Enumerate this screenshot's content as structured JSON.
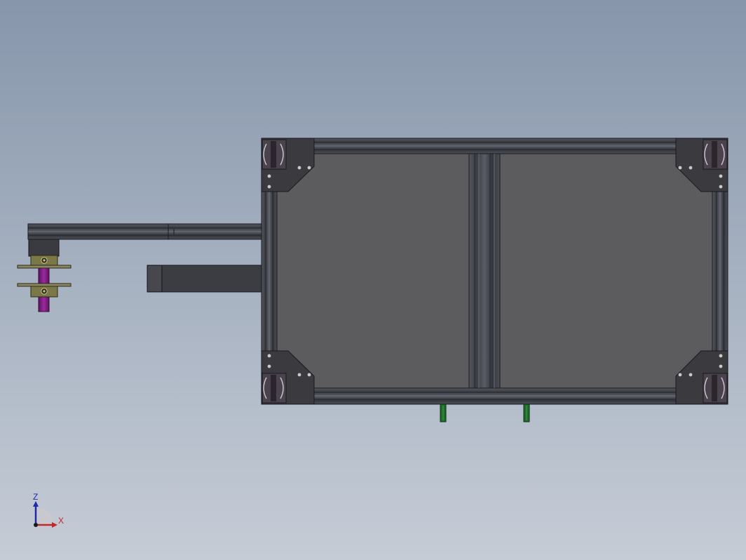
{
  "view": {
    "background_top": "#8796ab",
    "background_bottom": "#c6ccd6"
  },
  "model": {
    "frame_color": "#3c3e46",
    "panel_color": "#5c5c5f",
    "bracket_color": "#3a3a3f",
    "leg_color": "#1f6b2a",
    "clamp_color": "#7b7848",
    "shaft_color": "#7a1a7e"
  },
  "triad": {
    "z_label": "Z",
    "x_label": "X",
    "z_color": "#1d2aa8",
    "x_color": "#c0282b"
  }
}
